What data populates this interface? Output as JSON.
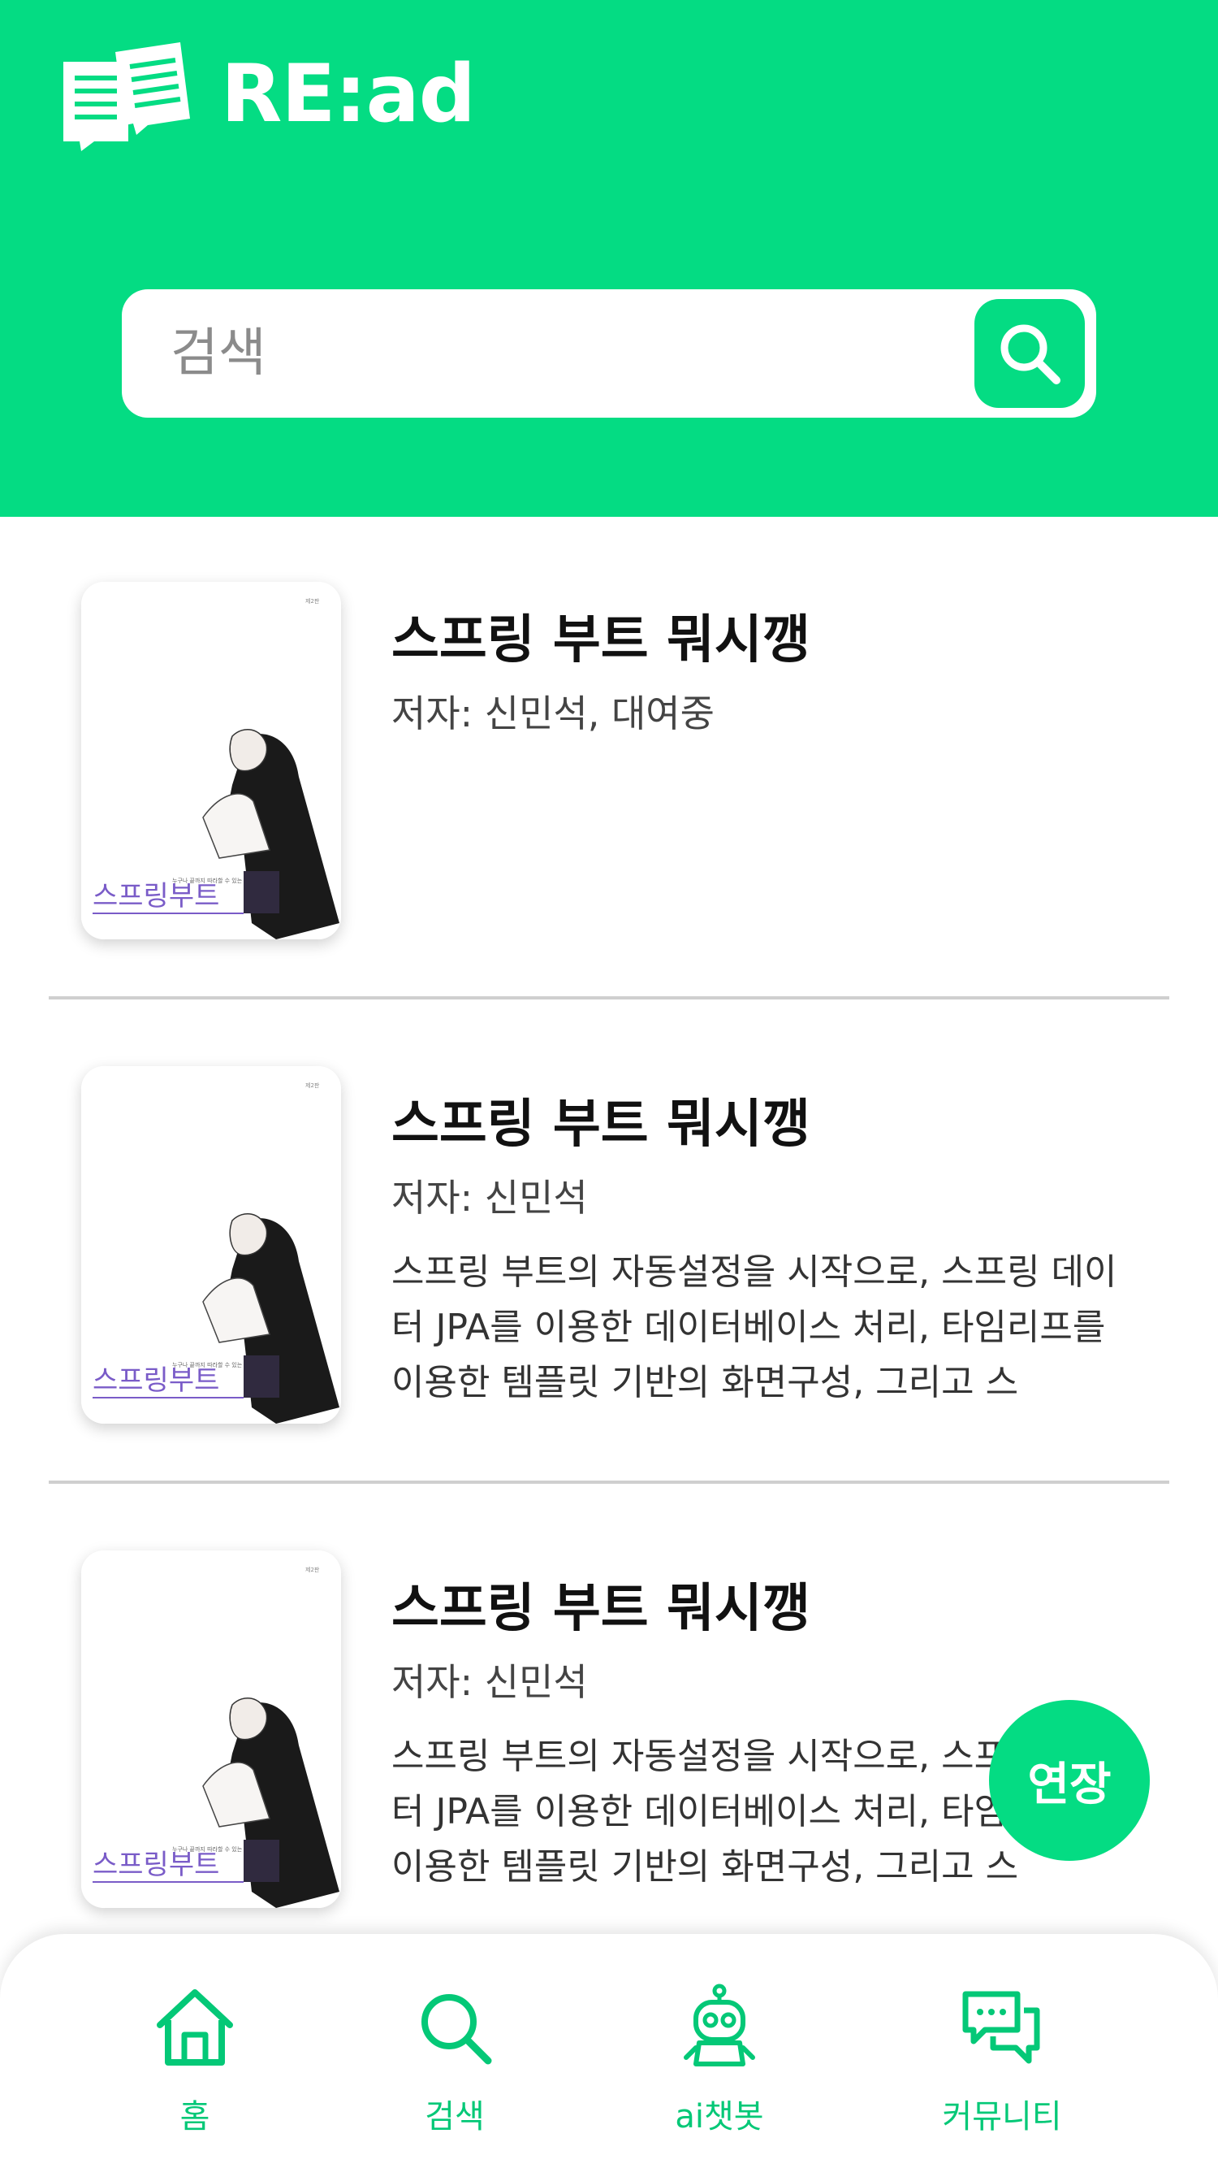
{
  "app": {
    "name": "RE:ad",
    "accent_color": "#04dc83"
  },
  "search": {
    "placeholder": "검색",
    "button_icon": "search-icon"
  },
  "books": [
    {
      "title": "스프링 부트 뭐시깽",
      "author": "저자: 신민석, 대여중",
      "description": "",
      "cover_title": "스프링부트",
      "cover_subtitle": "누구나 끝까지 따라할 수 있는"
    },
    {
      "title": "스프링 부트 뭐시깽",
      "author": "저자: 신민석",
      "description": "스프링 부트의 자동설정을 시작으로, 스프링 데이터 JPA를 이용한 데이터베이스 처리, 타임리프를 이용한 템플릿 기반의 화면구성, 그리고 스",
      "cover_title": "스프링부트",
      "cover_subtitle": "누구나 끝까지 따라할 수 있는"
    },
    {
      "title": "스프링 부트 뭐시깽",
      "author": "저자: 신민석",
      "description": "스프링 부트의 자동설정을 시작으로, 스프링 데이터 JPA를 이용한 데이터베이스 처리, 타임리프를 이용한 템플릿 기반의 화면구성, 그리고 스",
      "cover_title": "스프링부트",
      "cover_subtitle": "누구나 끝까지 따라할 수 있는"
    }
  ],
  "fab": {
    "label": "연장"
  },
  "bottom_nav": [
    {
      "label": "홈",
      "icon": "home-icon"
    },
    {
      "label": "검색",
      "icon": "search-icon"
    },
    {
      "label": "ai챗봇",
      "icon": "robot-icon"
    },
    {
      "label": "커뮤니티",
      "icon": "chat-bubbles-icon"
    }
  ]
}
